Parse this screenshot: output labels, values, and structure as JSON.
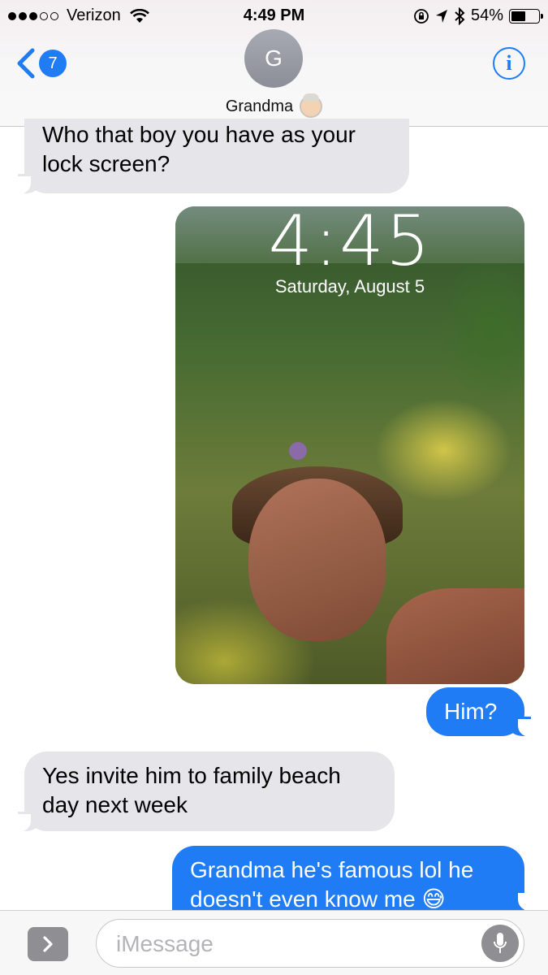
{
  "status_bar": {
    "signal_strength": "3 of 5",
    "carrier": "Verizon",
    "time": "4:49 PM",
    "battery_percent": "54%",
    "battery_level": 0.54,
    "icons": [
      "wifi-icon",
      "rotation-lock-icon",
      "location-icon",
      "bluetooth-icon",
      "battery-icon"
    ]
  },
  "header": {
    "back_badge_count": "7",
    "avatar_initial": "G",
    "contact_name": "Grandma",
    "contact_emoji": "older-woman-emoji",
    "info_icon": "i"
  },
  "messages": [
    {
      "direction": "incoming",
      "lines": [
        "Who that boy you have as your",
        "lock screen?"
      ]
    },
    {
      "direction": "outgoing",
      "type": "image",
      "lock_time": "4:45",
      "lock_date": "Saturday, August 5"
    },
    {
      "direction": "outgoing",
      "lines": [
        "Him?"
      ]
    },
    {
      "direction": "incoming",
      "lines": [
        "Yes invite him to family beach",
        "day next week"
      ]
    },
    {
      "direction": "outgoing",
      "lines": [
        "Grandma he's famous lol he",
        "doesn't even know me 😅"
      ]
    }
  ],
  "composer": {
    "placeholder": "iMessage"
  },
  "colors": {
    "accent_blue": "#1f7cf4",
    "incoming_bubble": "#e5e5ea",
    "outgoing_bubble": "#1f7cf4"
  }
}
